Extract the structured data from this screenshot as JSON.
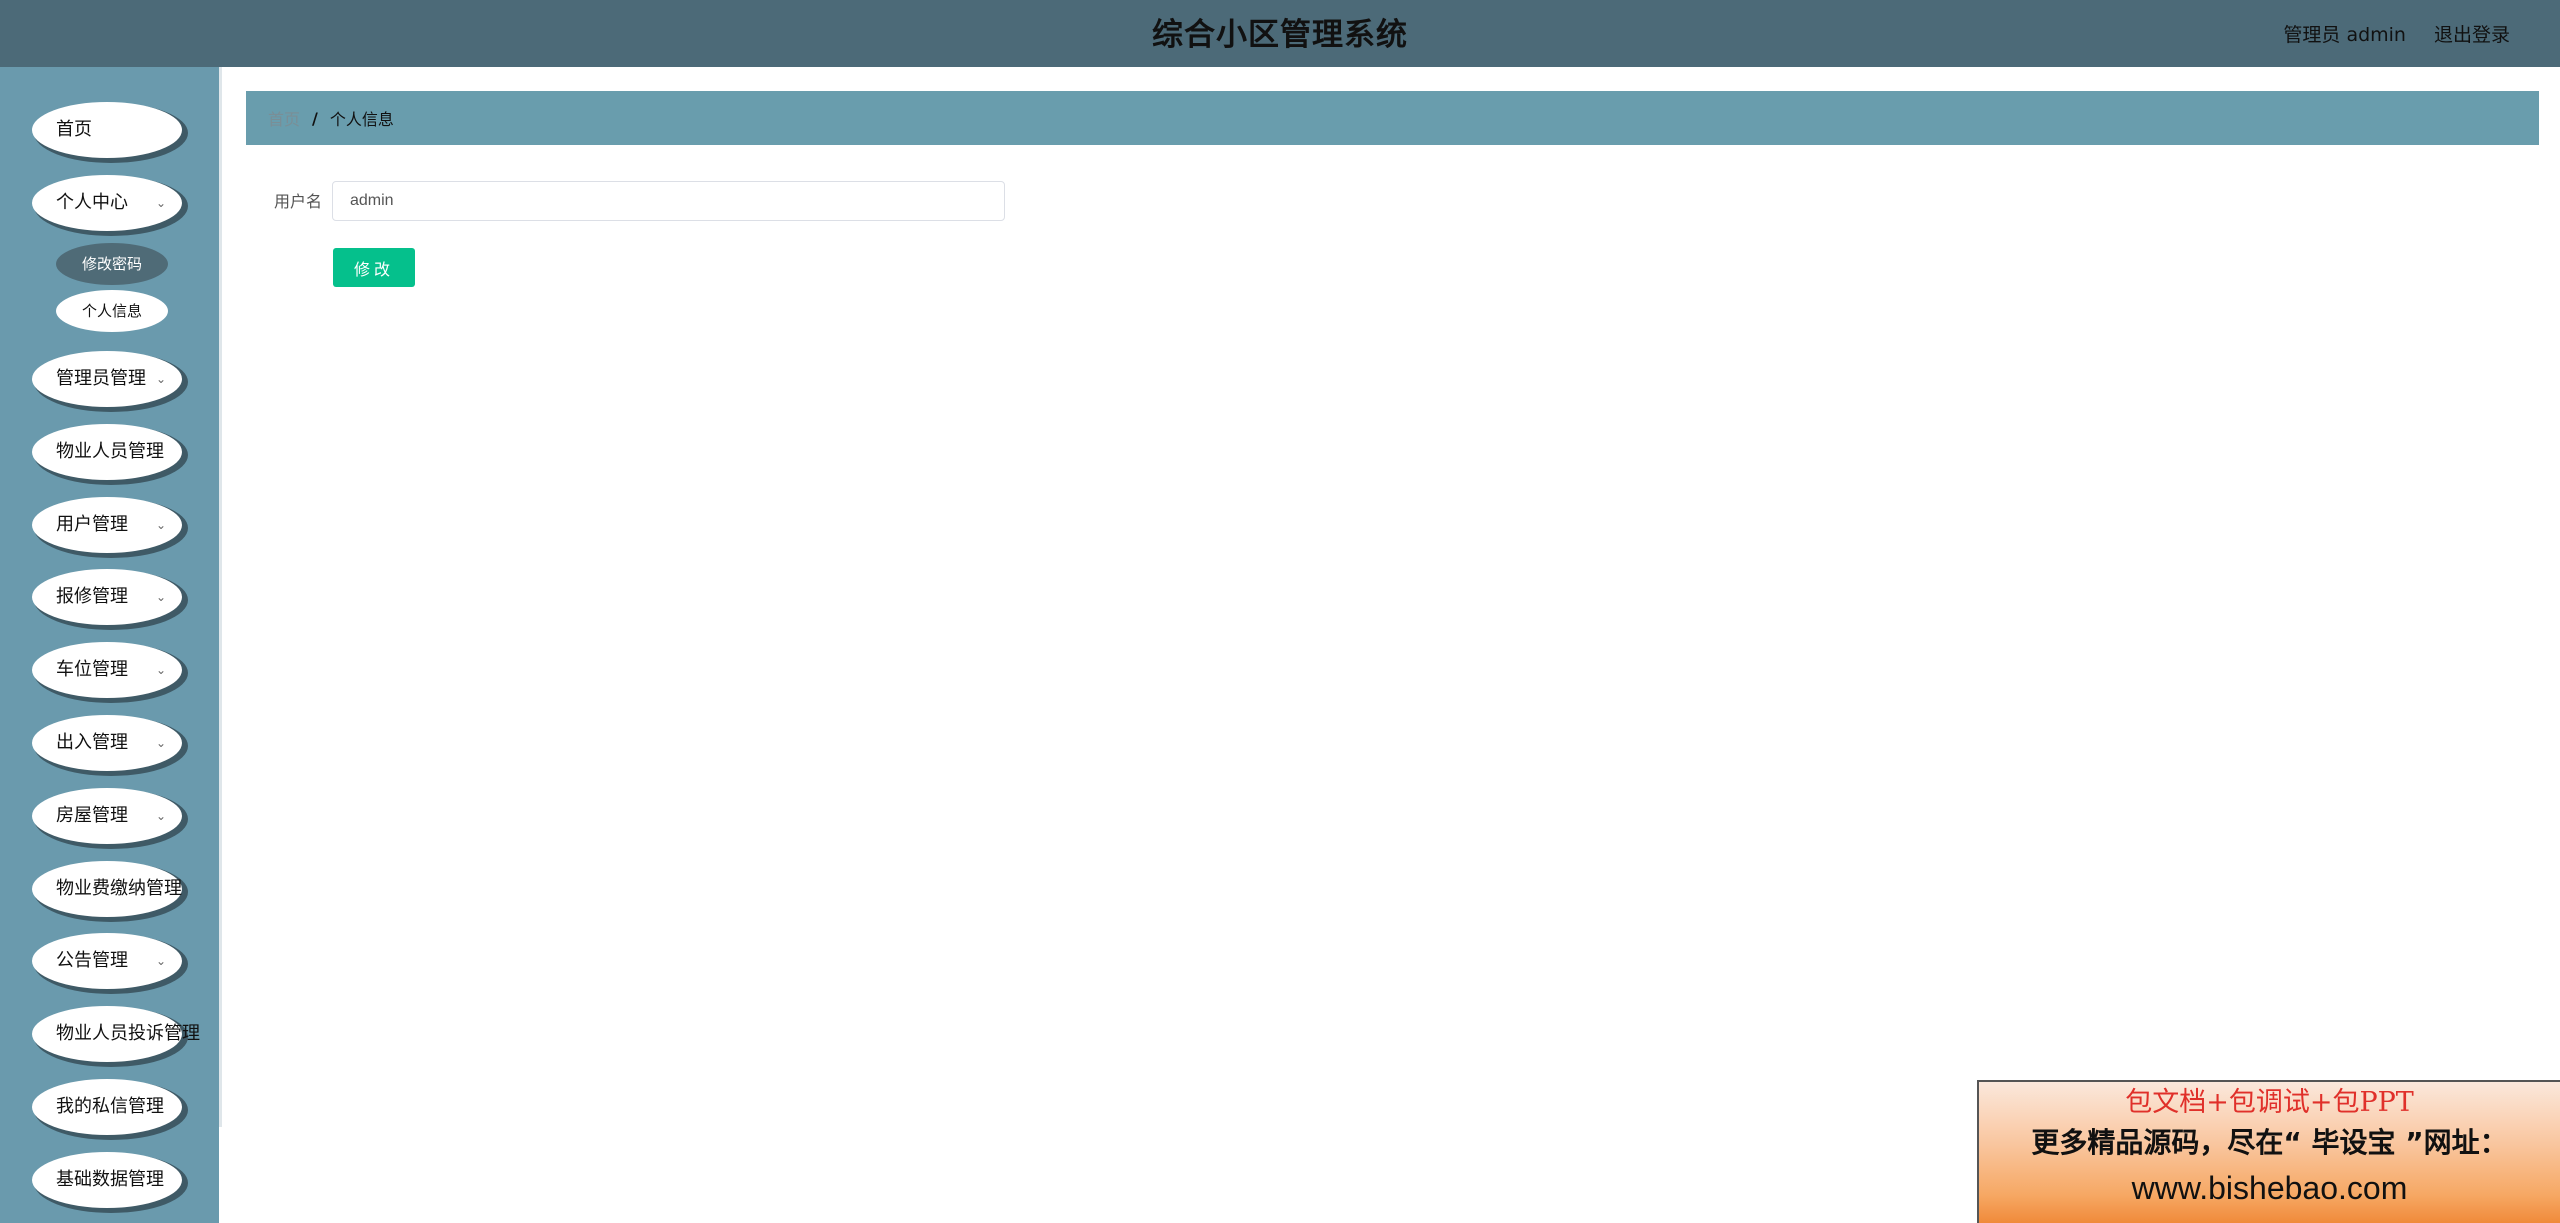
{
  "header": {
    "title": "综合小区管理系统",
    "user_label": "管理员 admin",
    "logout_label": "退出登录"
  },
  "sidebar": {
    "items": [
      {
        "label": "首页",
        "has_submenu": false
      },
      {
        "label": "个人中心",
        "has_submenu": true,
        "expanded": true,
        "children": [
          {
            "label": "修改密码",
            "active": true
          },
          {
            "label": "个人信息",
            "active": false
          }
        ]
      },
      {
        "label": "管理员管理",
        "has_submenu": true
      },
      {
        "label": "物业人员管理",
        "has_submenu": false
      },
      {
        "label": "用户管理",
        "has_submenu": true
      },
      {
        "label": "报修管理",
        "has_submenu": true
      },
      {
        "label": "车位管理",
        "has_submenu": true
      },
      {
        "label": "出入管理",
        "has_submenu": true
      },
      {
        "label": "房屋管理",
        "has_submenu": true
      },
      {
        "label": "物业费缴纳管理",
        "has_submenu": false
      },
      {
        "label": "公告管理",
        "has_submenu": true
      },
      {
        "label": "物业人员投诉管理",
        "has_submenu": false
      },
      {
        "label": "我的私信管理",
        "has_submenu": false
      },
      {
        "label": "基础数据管理",
        "has_submenu": false
      }
    ]
  },
  "breadcrumb": {
    "home": "首页",
    "separator": "/",
    "current": "个人信息"
  },
  "form": {
    "username_label": "用户名",
    "username_value": "admin",
    "submit_label": "修改"
  },
  "promo": {
    "line1": "包文档+包调试+包PPT",
    "line2": "更多精品源码，尽在“ 毕设宝 ”网址：",
    "line3": "www.bishebao.com"
  },
  "colors": {
    "topbar": "#4c6a78",
    "sidebar": "#6a9aad",
    "breadcrumb_bar": "#699dad",
    "primary_button": "#05c08c",
    "active_submenu": "#4f6b77"
  }
}
